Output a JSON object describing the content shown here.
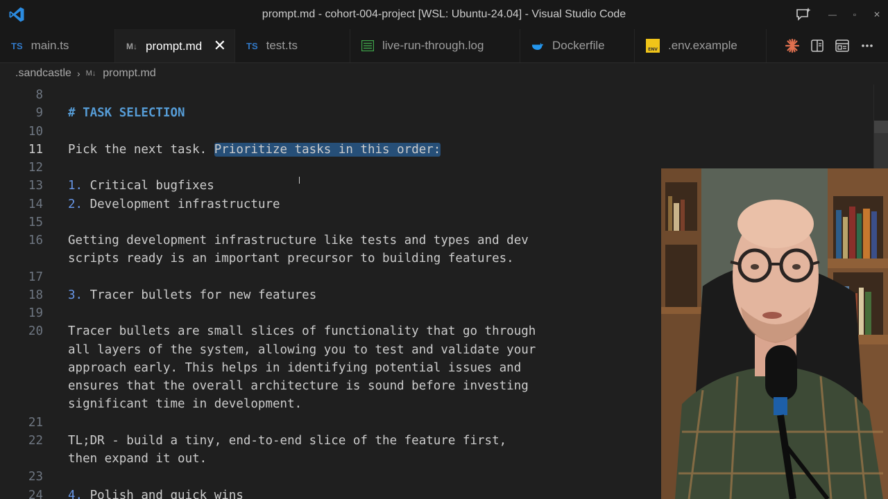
{
  "window": {
    "title": "prompt.md - cohort-004-project [WSL: Ubuntu-24.04] - Visual Studio Code"
  },
  "tabs": [
    {
      "icon": "TS",
      "label": "main.ts"
    },
    {
      "icon": "M↓",
      "label": "prompt.md",
      "active": true
    },
    {
      "icon": "TS",
      "label": "test.ts"
    },
    {
      "icon": "log",
      "label": "live-run-through.log"
    },
    {
      "icon": "docker",
      "label": "Dockerfile"
    },
    {
      "icon": "ENV",
      "label": ".env.example"
    }
  ],
  "breadcrumb": {
    "folder": ".sandcastle",
    "file_icon": "M↓",
    "file": "prompt.md"
  },
  "editor": {
    "lines": [
      {
        "n": "8",
        "text": ""
      },
      {
        "n": "9",
        "text": "# TASK SELECTION"
      },
      {
        "n": "10",
        "text": ""
      },
      {
        "n": "11",
        "pre": "Pick the next task. ",
        "sel": "Prioritize tasks in this order:"
      },
      {
        "n": "12",
        "text": ""
      },
      {
        "n": "13",
        "num": "1.",
        "text": " Critical bugfixes"
      },
      {
        "n": "14",
        "num": "2.",
        "text": " Development infrastructure"
      },
      {
        "n": "15",
        "text": ""
      },
      {
        "n": "16",
        "text": "Getting development infrastructure like tests and types and dev"
      },
      {
        "n": "",
        "text": "scripts ready is an important precursor to building features."
      },
      {
        "n": "17",
        "text": ""
      },
      {
        "n": "18",
        "num": "3.",
        "text": " Tracer bullets for new features"
      },
      {
        "n": "19",
        "text": ""
      },
      {
        "n": "20",
        "text": "Tracer bullets are small slices of functionality that go through"
      },
      {
        "n": "",
        "text": "all layers of the system, allowing you to test and validate your"
      },
      {
        "n": "",
        "text": "approach early. This helps in identifying potential issues and"
      },
      {
        "n": "",
        "text": "ensures that the overall architecture is sound before investing"
      },
      {
        "n": "",
        "text": "significant time in development."
      },
      {
        "n": "21",
        "text": ""
      },
      {
        "n": "22",
        "text": "TL;DR - build a tiny, end-to-end slice of the feature first,"
      },
      {
        "n": "",
        "text": "then expand it out."
      },
      {
        "n": "23",
        "text": ""
      },
      {
        "n": "24",
        "num": "4.",
        "text": " Polish and quick wins"
      }
    ]
  },
  "colors": {
    "accent": "#0078d4",
    "heading": "#569cd6",
    "selection": "#264f78",
    "editor_bg": "#1f1f1f"
  }
}
